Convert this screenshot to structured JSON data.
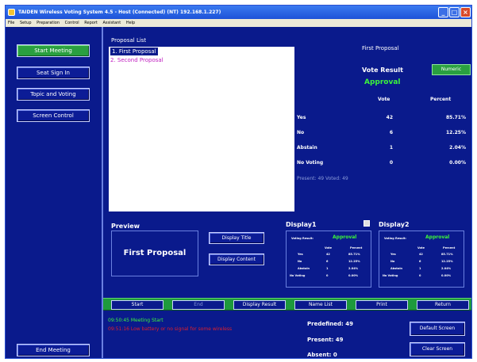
{
  "window": {
    "title": "TAIDEN Wireless Voting System 4.5 - Host (Connected) (NT) 192.168.1.227)",
    "menu": [
      "File",
      "Setup",
      "Preparation",
      "Control",
      "Report",
      "Assistant",
      "Help"
    ]
  },
  "sidebar": {
    "start_meeting": "Start Meeting",
    "seat_sign_in": "Seat Sign In",
    "topic_and_voting": "Topic and Voting",
    "screen_control": "Screen Control",
    "end_meeting": "End Meeting"
  },
  "proposal_list": {
    "label": "Proposal List",
    "items": [
      "1. First Proposal",
      "2. Second Proposal"
    ]
  },
  "result_panel": {
    "proposal_name": "First Proposal",
    "vote_result_label": "Vote Result",
    "numeric_button": "Numeric",
    "result": "Approval",
    "col_vote": "Vote",
    "col_percent": "Percent",
    "rows": [
      {
        "label": "Yes",
        "vote": "42",
        "percent": "85.71%"
      },
      {
        "label": "No",
        "vote": "6",
        "percent": "12.25%"
      },
      {
        "label": "Abstain",
        "vote": "1",
        "percent": "2.04%"
      },
      {
        "label": "No Voting",
        "vote": "0",
        "percent": "0.00%"
      }
    ],
    "present_voted": "Present: 49  Voted: 49"
  },
  "preview": {
    "label": "Preview",
    "text": "First Proposal",
    "display_title_button": "Display Title",
    "display_content_button": "Display Content"
  },
  "display1": {
    "label": "Display1",
    "voting_result_label": "Voting Result:",
    "result": "Approval",
    "col_vote": "Vote",
    "col_percent": "Percent",
    "rows": [
      {
        "label": "Yes",
        "vote": "42",
        "percent": "85.71%"
      },
      {
        "label": "No",
        "vote": "6",
        "percent": "12.25%"
      },
      {
        "label": "Abstain",
        "vote": "1",
        "percent": "2.04%"
      },
      {
        "label": "No Voting",
        "vote": "0",
        "percent": "0.00%"
      }
    ]
  },
  "display2": {
    "label": "Display2",
    "voting_result_label": "Voting Result:",
    "result": "Approval",
    "col_vote": "Vote",
    "col_percent": "Percent",
    "rows": [
      {
        "label": "Yes",
        "vote": "42",
        "percent": "85.71%"
      },
      {
        "label": "No",
        "vote": "6",
        "percent": "12.25%"
      },
      {
        "label": "Abstain",
        "vote": "1",
        "percent": "2.04%"
      },
      {
        "label": "No Voting",
        "vote": "0",
        "percent": "0.00%"
      }
    ]
  },
  "toolbar": {
    "start": "Start",
    "end": "End",
    "display_result": "Display Result",
    "name_list": "Name List",
    "print": "Print",
    "return": "Return"
  },
  "log": {
    "line1": "09:50:45 Meeting Start",
    "line2": "09:51:16 Low battery or no signal for some wireless"
  },
  "stats": {
    "predefined": "Predefined: 49",
    "present": "Present: 49",
    "absent": "Absent: 0"
  },
  "screen_buttons": {
    "default_screen": "Default Screen",
    "clear_screen": "Clear Screen"
  },
  "colors": {
    "background": "#0a1a8c",
    "accent_green": "#2aa040",
    "result_green": "#3cf43c",
    "log_green": "#3cf43c",
    "log_red": "#e0202a",
    "proposal_pink": "#c020c0"
  }
}
